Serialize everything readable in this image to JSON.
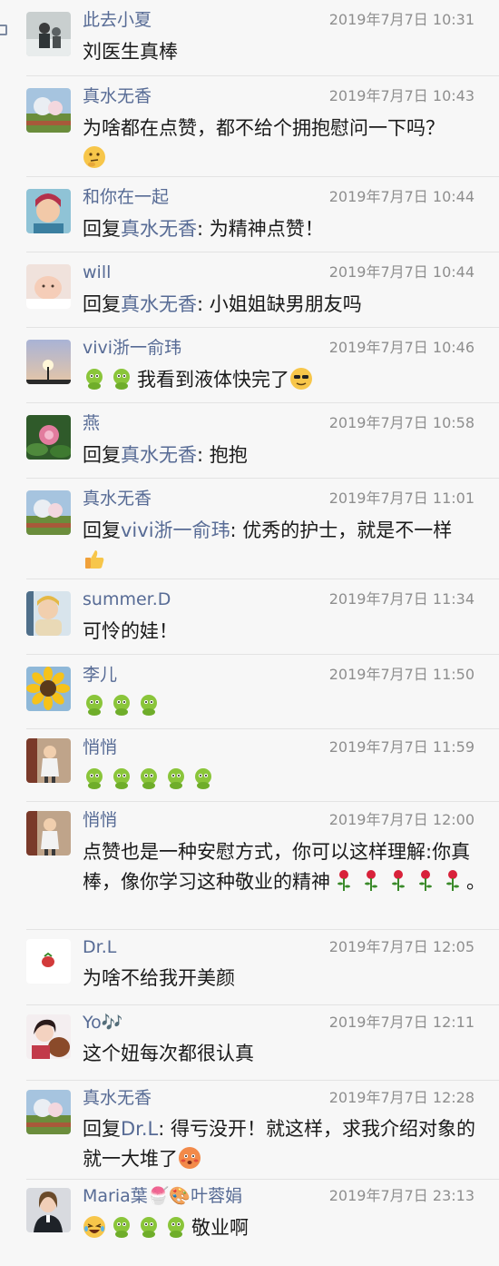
{
  "colors": {
    "name": "#576b95",
    "time": "#8e8e8e",
    "text": "#1a1a1a",
    "background": "#f7f7f7"
  },
  "comments": [
    {
      "author": "此去小夏",
      "time": "2019年7月7日 10:31",
      "text": "刘医生真棒"
    },
    {
      "author": "真水无香",
      "time": "2019年7月7日 10:43",
      "text": "为啥都在点赞，都不给个拥抱慰问一下吗？",
      "emoji_tail": "thinking-emoji"
    },
    {
      "author": "和你在一起",
      "time": "2019年7月7日 10:44",
      "reply_prefix": "回复",
      "reply_to": "真水无香",
      "text": ": 为精神点赞！"
    },
    {
      "author": "will",
      "time": "2019年7月7日 10:44",
      "reply_prefix": "回复",
      "reply_to": "真水无香",
      "text": ": 小姐姐缺男朋友吗"
    },
    {
      "author": "vivi浙一俞玮",
      "time": "2019年7月7日 10:46",
      "emoji_head": [
        "green-face-emoji",
        "green-face-emoji"
      ],
      "text": "我看到液体快完了",
      "emoji_tail": "sunglasses-emoji"
    },
    {
      "author": "燕",
      "time": "2019年7月7日 10:58",
      "reply_prefix": "回复",
      "reply_to": "真水无香",
      "text": ": 抱抱"
    },
    {
      "author": "真水无香",
      "time": "2019年7月7日 11:01",
      "reply_prefix": "回复",
      "reply_to": "vivi浙一俞玮",
      "text": ": 优秀的护士，就是不一样",
      "emoji_tail": "thumbs-up-emoji"
    },
    {
      "author": "summer.D",
      "time": "2019年7月7日 11:34",
      "text": "可怜的娃！"
    },
    {
      "author": "李儿",
      "time": "2019年7月7日 11:50",
      "emoji_head": [
        "green-face-emoji",
        "green-face-emoji",
        "green-face-emoji"
      ],
      "text": ""
    },
    {
      "author": "悄悄",
      "time": "2019年7月7日 11:59",
      "emoji_head": [
        "green-face-emoji",
        "green-face-emoji",
        "green-face-emoji",
        "green-face-emoji",
        "green-face-emoji"
      ],
      "text": ""
    },
    {
      "author": "悄悄",
      "time": "2019年7月7日 12:00",
      "text": "点赞也是一种安慰方式，你可以这样理解:你真棒，像你学习这种敬业的精神",
      "roses": 5,
      "text_end": "。"
    },
    {
      "author": "Dr.L",
      "time": "2019年7月7日 12:05",
      "text": "为啥不给我开美颜"
    },
    {
      "author": "Yo🎶",
      "time": "2019年7月7日 12:11",
      "text": "这个妞每次都很认真"
    },
    {
      "author": "真水无香",
      "time": "2019年7月7日 12:28",
      "reply_prefix": "回复",
      "reply_to": "Dr.L",
      "text": ": 得亏没开！就这样，求我介绍对象的就一大堆了",
      "emoji_tail": "blushing-emoji"
    },
    {
      "author": "Maria葉🍧🎨叶蓉娟",
      "time": "2019年7月7日 23:13",
      "emoji_head": [
        "laughing-tears-emoji",
        "green-face-emoji",
        "green-face-emoji",
        "green-face-emoji"
      ],
      "text": "敬业啊"
    }
  ]
}
